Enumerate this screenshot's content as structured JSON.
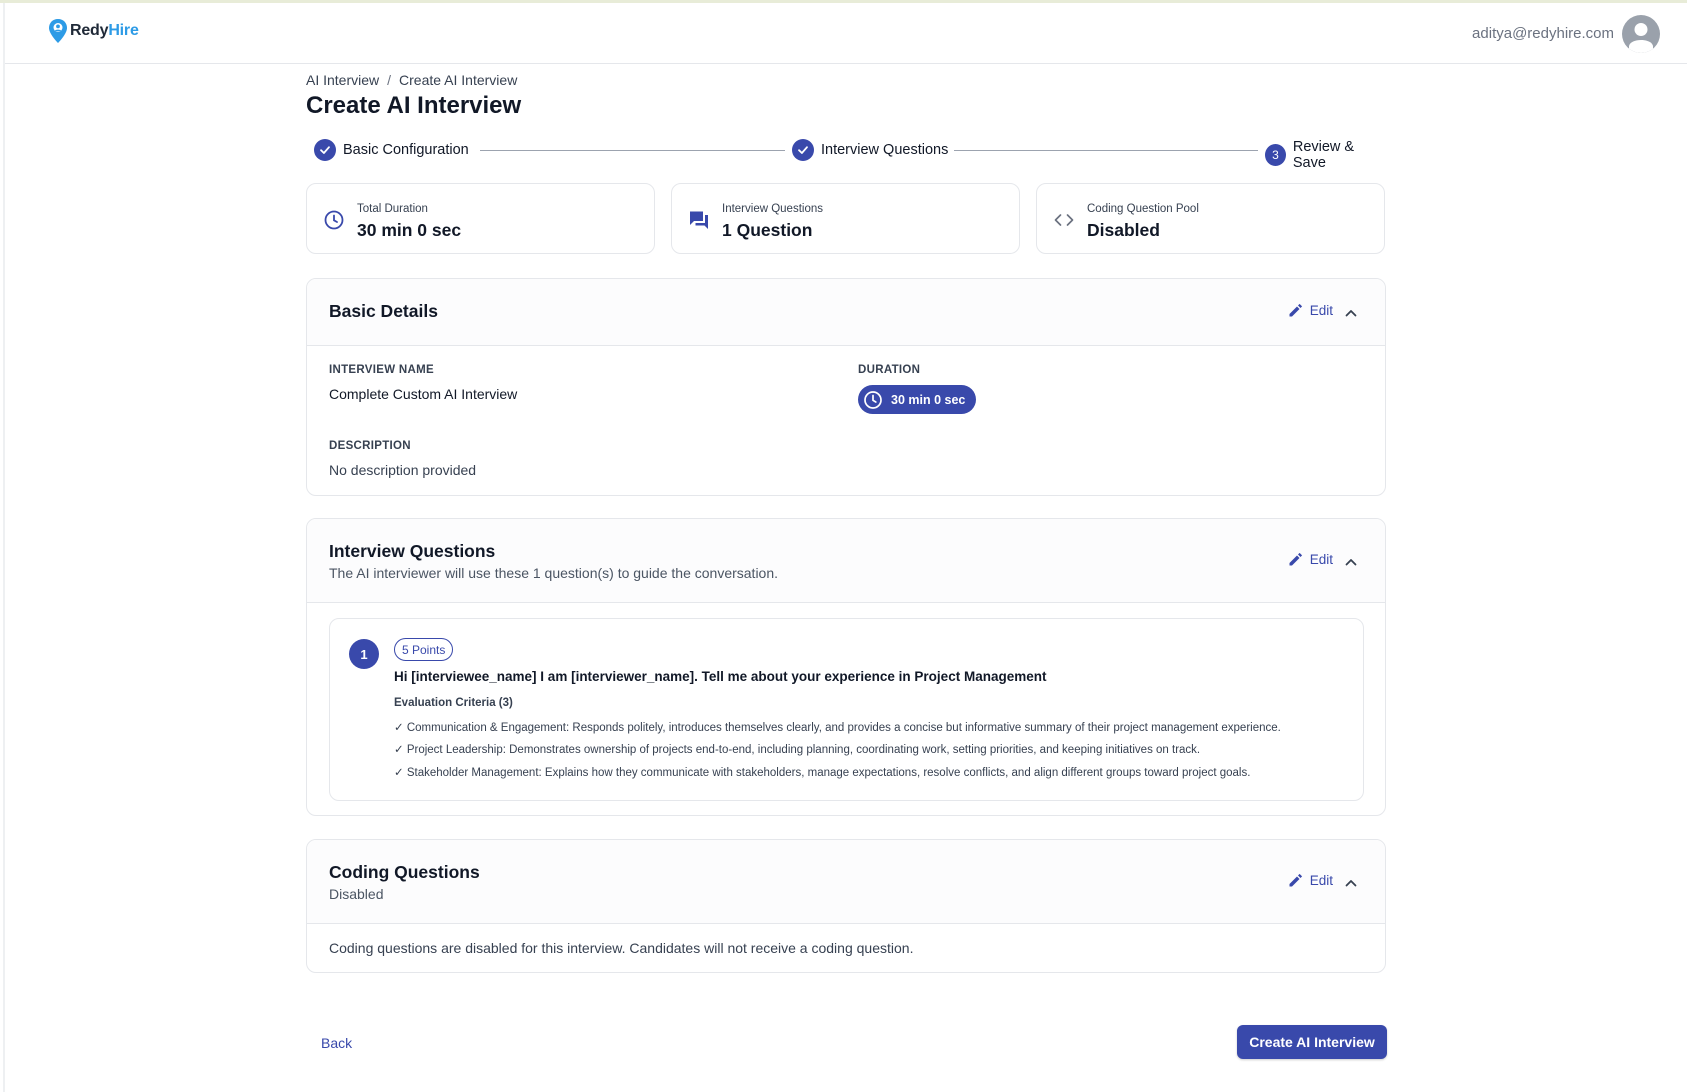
{
  "header": {
    "logo": {
      "part1": "Redy",
      "part2": "Hire"
    },
    "user_email": "aditya@redyhire.com"
  },
  "breadcrumb": {
    "parent": "AI Interview",
    "separator": "/",
    "current": "Create AI Interview"
  },
  "page_title": "Create AI Interview",
  "stepper": {
    "steps": [
      {
        "label": "Basic Configuration",
        "state": "complete"
      },
      {
        "label": "Interview Questions",
        "state": "complete"
      },
      {
        "label": "Review & Save",
        "state": "current",
        "number": "3"
      }
    ]
  },
  "stats": [
    {
      "label": "Total Duration",
      "value": "30 min 0 sec",
      "icon": "clock-icon"
    },
    {
      "label": "Interview Questions",
      "value": "1 Question",
      "icon": "chat-icon"
    },
    {
      "label": "Coding Question Pool",
      "value": "Disabled",
      "icon": "code-icon"
    }
  ],
  "basic_details": {
    "title": "Basic Details",
    "edit_label": "Edit",
    "name_label": "INTERVIEW NAME",
    "name_value": "Complete Custom AI Interview",
    "duration_label": "DURATION",
    "duration_value": "30 min 0 sec",
    "description_label": "DESCRIPTION",
    "description_value": "No description provided"
  },
  "interview_questions": {
    "title": "Interview Questions",
    "subtitle": "The AI interviewer will use these 1 question(s) to guide the conversation.",
    "edit_label": "Edit",
    "questions": [
      {
        "number": "1",
        "points": "5 Points",
        "text": "Hi [interviewee_name] I am [interviewer_name]. Tell me about your experience in Project Management",
        "criteria_title": "Evaluation Criteria (3)",
        "criteria": [
          "✓ Communication & Engagement: Responds politely, introduces themselves clearly, and provides a concise but informative summary of their project management experience.",
          "✓ Project Leadership: Demonstrates ownership of projects end-to-end, including planning, coordinating work, setting priorities, and keeping initiatives on track.",
          "✓ Stakeholder Management: Explains how they communicate with stakeholders, manage expectations, resolve conflicts, and align different groups toward project goals."
        ]
      }
    ]
  },
  "coding_questions": {
    "title": "Coding Questions",
    "subtitle": "Disabled",
    "edit_label": "Edit",
    "message": "Coding questions are disabled for this interview. Candidates will not receive a coding question."
  },
  "footer": {
    "back_label": "Back",
    "create_label": "Create AI Interview"
  },
  "colors": {
    "primary": "#3949ab",
    "brand_blue": "#2d9be6",
    "border": "#e5e7eb"
  }
}
